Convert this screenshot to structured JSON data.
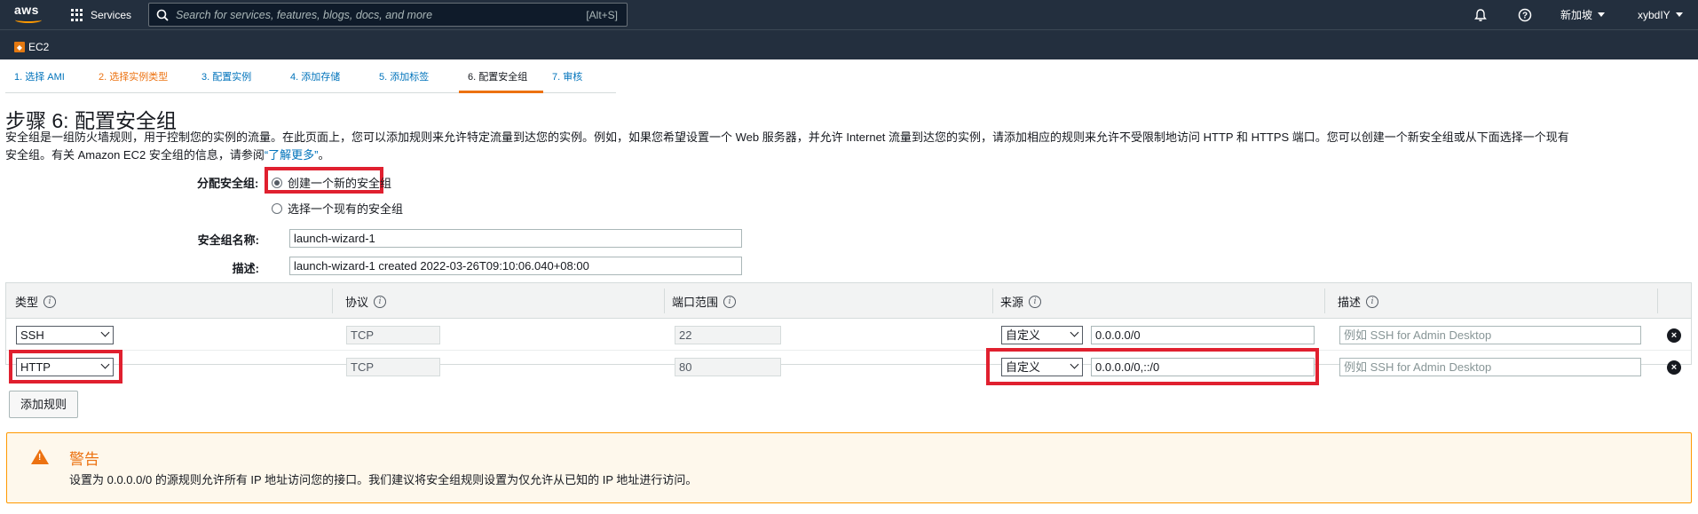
{
  "topnav": {
    "logo_text": "aws",
    "services_label": "Services",
    "search_placeholder": "Search for services, features, blogs, docs, and more",
    "search_shortcut": "[Alt+S]",
    "region": "新加坡",
    "account": "xybdIY"
  },
  "subnav": {
    "service": "EC2"
  },
  "wizard_tabs": [
    {
      "label": "1. 选择 AMI",
      "state": "done"
    },
    {
      "label": "2. 选择实例类型",
      "state": "visited"
    },
    {
      "label": "3. 配置实例",
      "state": "done"
    },
    {
      "label": "4. 添加存储",
      "state": "done"
    },
    {
      "label": "5. 添加标签",
      "state": "done"
    },
    {
      "label": "6. 配置安全组",
      "state": "active"
    },
    {
      "label": "7. 审核",
      "state": "done"
    }
  ],
  "page": {
    "title": "步骤 6: 配置安全组",
    "intro_line1": "安全组是一组防火墙规则，用于控制您的实例的流量。在此页面上，您可以添加规则来允许特定流量到达您的实例。例如，如果您希望设置一个 Web 服务器，并允许 Internet 流量到达您的实例，请添加相应的规则来允许不受限制地访问 HTTP 和 HTTPS 端口。您可以创建一个新安全组或从下面选择一个现有",
    "intro_line2": "安全组。有关 Amazon EC2 安全组的信息，请参阅",
    "learn_more": "“了解更多”",
    "intro_end": "。"
  },
  "assign": {
    "label": "分配安全组:",
    "option_new": "创建一个新的安全组",
    "option_existing": "选择一个现有的安全组"
  },
  "form": {
    "name_label": "安全组名称:",
    "name_value": "launch-wizard-1",
    "desc_label": "描述:",
    "desc_value": "launch-wizard-1 created 2022-03-26T09:10:06.040+08:00"
  },
  "rules_table": {
    "headers": [
      "类型",
      "协议",
      "端口范围",
      "来源",
      "描述"
    ],
    "rows": [
      {
        "type": "SSH",
        "protocol": "TCP",
        "port": "22",
        "source_mode": "自定义",
        "source": "0.0.0.0/0",
        "desc_placeholder": "例如 SSH for Admin Desktop"
      },
      {
        "type": "HTTP",
        "protocol": "TCP",
        "port": "80",
        "source_mode": "自定义",
        "source": "0.0.0.0/0,::/0",
        "desc_placeholder": "例如 SSH for Admin Desktop"
      }
    ]
  },
  "add_rule_label": "添加规则",
  "warning": {
    "title": "警告",
    "text": "设置为 0.0.0.0/0 的源规则允许所有 IP 地址访问您的接口。我们建议将安全组规则设置为仅允许从已知的 IP 地址进行访问。"
  },
  "colors": {
    "nav_bg": "#232f3e",
    "accent_orange": "#ec7211",
    "link_blue": "#0073bb",
    "highlight_red": "#e0202f"
  }
}
